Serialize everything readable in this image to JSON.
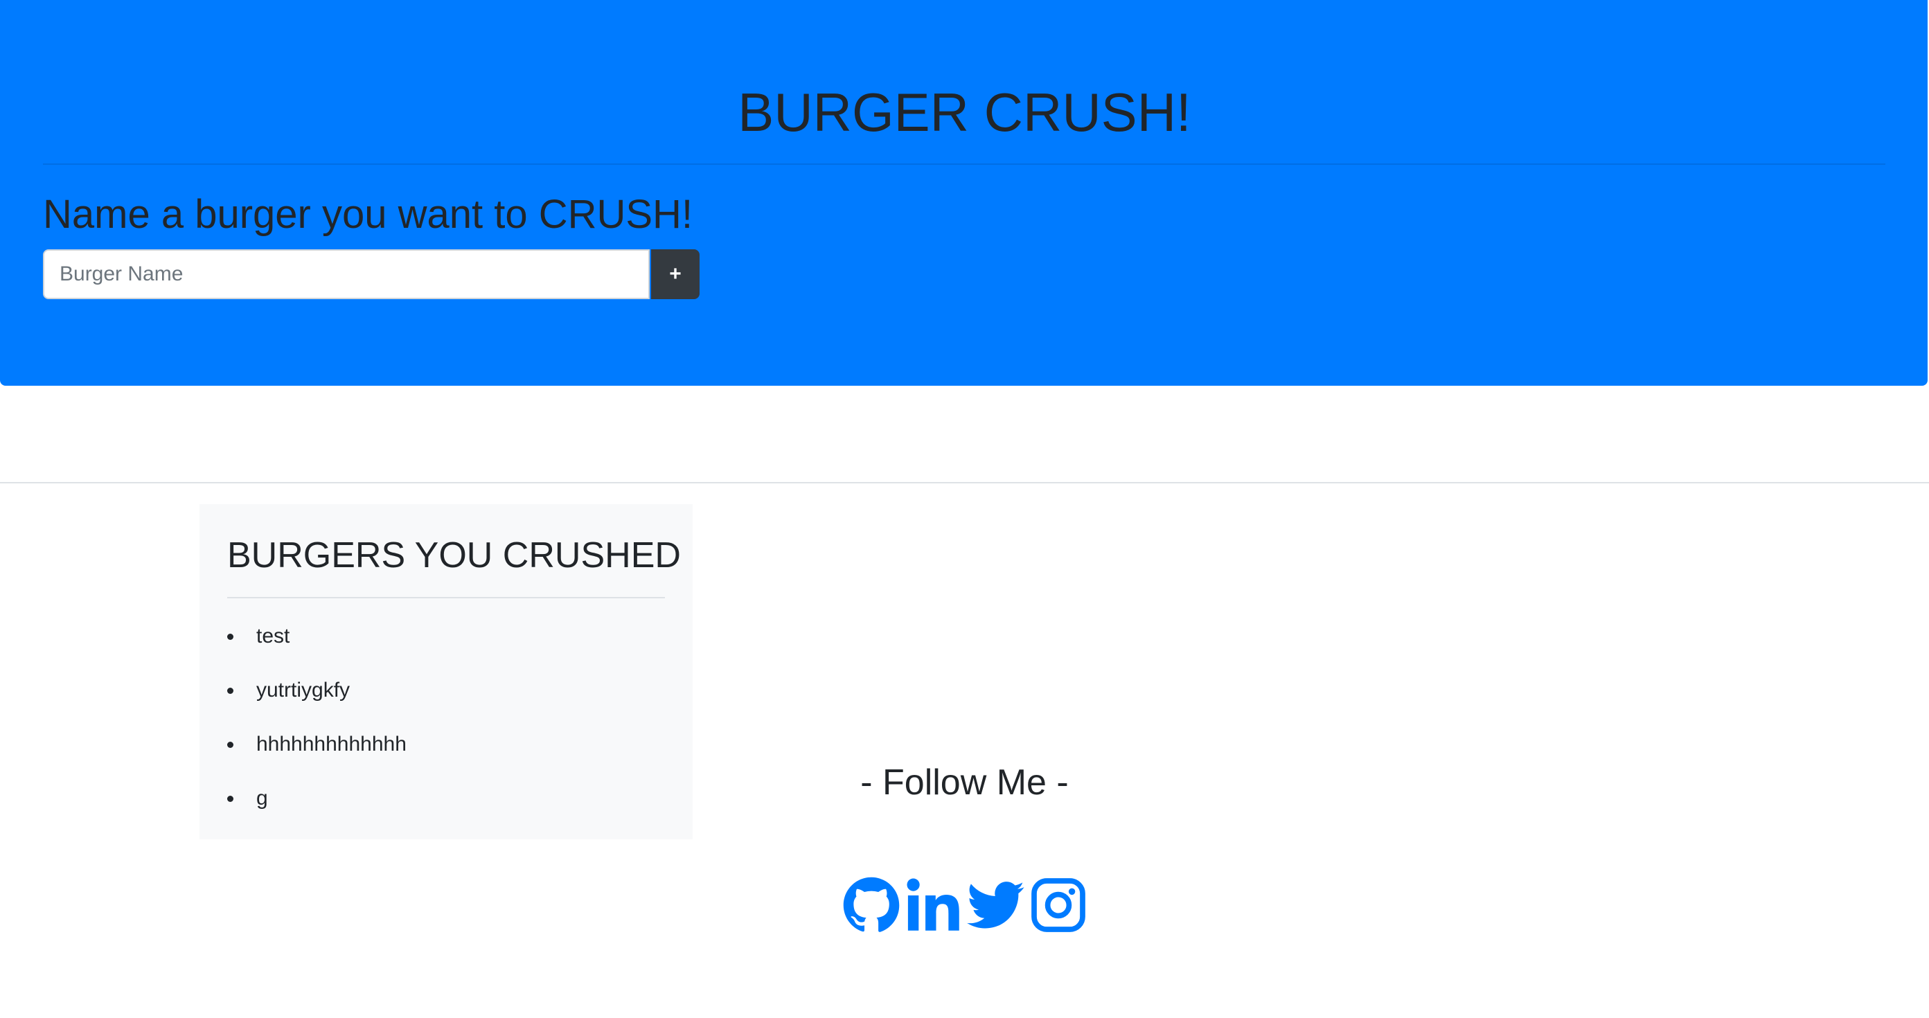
{
  "header": {
    "title": "BURGER CRUSH!",
    "form_heading": "Name a burger you want to CRUSH!",
    "input_placeholder": "Burger Name",
    "input_value": "",
    "add_button_label": "+"
  },
  "crushed": {
    "title": "BURGERS YOU CRUSHED",
    "items": [
      "test",
      "yutrtiygkfy",
      "hhhhhhhhhhhhh",
      "g"
    ]
  },
  "footer": {
    "follow_label": "- Follow Me -",
    "social": [
      {
        "icon": "github-icon"
      },
      {
        "icon": "linkedin-icon"
      },
      {
        "icon": "twitter-icon"
      },
      {
        "icon": "instagram-icon"
      }
    ]
  },
  "colors": {
    "primary": "#007bff",
    "button_dark": "#343a40",
    "card_background": "#f8f9fa",
    "text": "#212529"
  }
}
